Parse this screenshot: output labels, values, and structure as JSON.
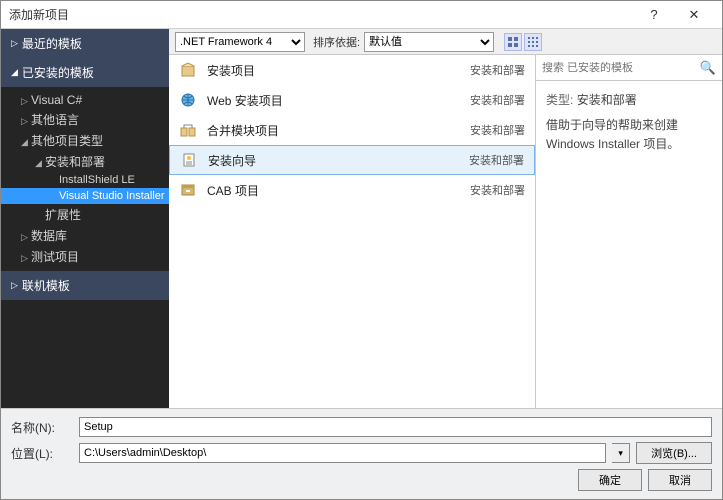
{
  "window": {
    "title": "添加新项目",
    "help": "?",
    "close": "✕"
  },
  "sidebar": {
    "recent": "最近的模板",
    "installed": "已安装的模板",
    "online": "联机模板",
    "tree": [
      {
        "label": "Visual C#",
        "depth": 1,
        "arrow": "▷"
      },
      {
        "label": "其他语言",
        "depth": 1,
        "arrow": "▷"
      },
      {
        "label": "其他项目类型",
        "depth": 1,
        "arrow": "◢"
      },
      {
        "label": "安装和部署",
        "depth": 2,
        "arrow": "◢"
      },
      {
        "label": "InstallShield LE",
        "depth": 3,
        "arrow": ""
      },
      {
        "label": "Visual Studio Installer",
        "depth": 3,
        "arrow": "",
        "selected": true
      },
      {
        "label": "扩展性",
        "depth": 2,
        "arrow": ""
      },
      {
        "label": "数据库",
        "depth": 1,
        "arrow": "▷"
      },
      {
        "label": "测试项目",
        "depth": 1,
        "arrow": "▷"
      }
    ]
  },
  "toolbar": {
    "framework": ".NET Framework 4",
    "sort_label": "排序依据:",
    "sort_value": "默认值"
  },
  "templates": [
    {
      "name": "安装项目",
      "category": "安装和部署",
      "icon": "box"
    },
    {
      "name": "Web 安装项目",
      "category": "安装和部署",
      "icon": "web"
    },
    {
      "name": "合并模块项目",
      "category": "安装和部署",
      "icon": "merge"
    },
    {
      "name": "安装向导",
      "category": "安装和部署",
      "icon": "wizard",
      "selected": true
    },
    {
      "name": "CAB 项目",
      "category": "安装和部署",
      "icon": "cab"
    }
  ],
  "details": {
    "search_placeholder": "搜索 已安装的模板",
    "type_label": "类型:",
    "type_value": "安装和部署",
    "description": "借助于向导的帮助来创建 Windows Installer 项目。"
  },
  "form": {
    "name_label": "名称(N):",
    "name_value": "Setup",
    "location_label": "位置(L):",
    "location_value": "C:\\Users\\admin\\Desktop\\",
    "browse": "浏览(B)...",
    "ok": "确定",
    "cancel": "取消"
  }
}
